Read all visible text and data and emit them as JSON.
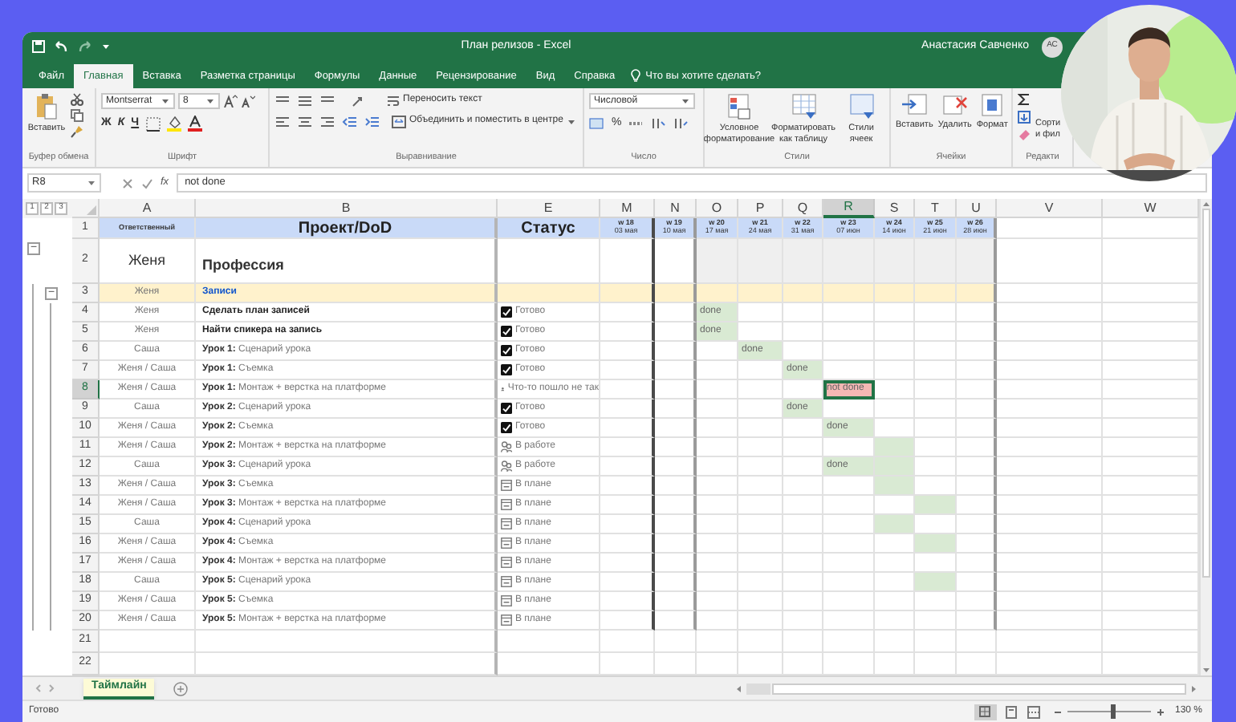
{
  "window": {
    "title": "План релизов  -  Excel",
    "user": "Анастасия Савченко",
    "avatar": "АС"
  },
  "tabs": [
    {
      "label": "Файл",
      "selected": false
    },
    {
      "label": "Главная",
      "selected": true
    },
    {
      "label": "Вставка",
      "selected": false
    },
    {
      "label": "Разметка страницы",
      "selected": false
    },
    {
      "label": "Формулы",
      "selected": false
    },
    {
      "label": "Данные",
      "selected": false
    },
    {
      "label": "Рецензирование",
      "selected": false
    },
    {
      "label": "Вид",
      "selected": false
    },
    {
      "label": "Справка",
      "selected": false
    }
  ],
  "tell_me": "Что вы хотите сделать?",
  "ribbon": {
    "clipboard": {
      "paste": "Вставить",
      "label": "Буфер обмена"
    },
    "font": {
      "name": "Montserrat",
      "size": "8",
      "styles": [
        "Ж",
        "К",
        "Ч"
      ],
      "label": "Шрифт"
    },
    "alignment": {
      "wrap": "Переносить текст",
      "merge": "Объединить и поместить в центре",
      "label": "Выравнивание"
    },
    "number": {
      "format": "Числовой",
      "percent": "%",
      "label": "Число"
    },
    "styles": {
      "buttons": [
        "Условное форматирование",
        "Форматировать как таблицу",
        "Стили ячеек"
      ],
      "label": "Стили"
    },
    "cells": {
      "buttons": [
        "Вставить",
        "Удалить",
        "Формат"
      ],
      "label": "Ячейки"
    },
    "editing": {
      "sort": [
        "Сорти",
        "и фил"
      ],
      "label": "Редакти"
    }
  },
  "formula_bar": {
    "name_box": "R8",
    "fx": "fx",
    "value": "not done"
  },
  "outline_levels": [
    "1",
    "2",
    "3"
  ],
  "columns": [
    {
      "letter": "A",
      "selected": false
    },
    {
      "letter": "B",
      "selected": false
    },
    {
      "letter": "E",
      "selected": false
    },
    {
      "letter": "M",
      "selected": false
    },
    {
      "letter": "N",
      "selected": false
    },
    {
      "letter": "O",
      "selected": false
    },
    {
      "letter": "P",
      "selected": false
    },
    {
      "letter": "Q",
      "selected": false
    },
    {
      "letter": "R",
      "selected": true
    },
    {
      "letter": "S",
      "selected": false
    },
    {
      "letter": "T",
      "selected": false
    },
    {
      "letter": "U",
      "selected": false
    },
    {
      "letter": "V",
      "selected": false
    },
    {
      "letter": "W",
      "selected": false
    }
  ],
  "header_row": {
    "number": "1",
    "responsible": "Ответственный",
    "project": "Проект/DoD",
    "status": "Статус",
    "weeks": [
      {
        "week": "w 18",
        "date": "03 мая"
      },
      {
        "week": "w 19",
        "date": "10 мая"
      },
      {
        "week": "w 20",
        "date": "17 мая"
      },
      {
        "week": "w 21",
        "date": "24 мая"
      },
      {
        "week": "w 22",
        "date": "31 мая"
      },
      {
        "week": "w 23",
        "date": "07 июн"
      },
      {
        "week": "w 24",
        "date": "14 июн"
      },
      {
        "week": "w 25",
        "date": "21 июн"
      },
      {
        "week": "w 26",
        "date": "28 июн"
      }
    ]
  },
  "rows": [
    {
      "number": "2",
      "kind": "group",
      "selected": false,
      "outline_toggle": "−",
      "responsible": "Женя",
      "task": "Профессия"
    },
    {
      "number": "3",
      "kind": "section",
      "selected": false,
      "outline_toggle": "−",
      "responsible": "Женя",
      "task": "Записи"
    },
    {
      "number": "4",
      "kind": "task",
      "selected": false,
      "bold": true,
      "responsible": "Женя",
      "task": "Сделать план записей",
      "status": {
        "kind": "done",
        "text": "Готово"
      },
      "weeks": [
        {
          "kind": "fill",
          "color": "#d9ead3",
          "text": "done"
        },
        {
          "kind": "blank"
        },
        {
          "kind": "blank"
        },
        {
          "kind": "blank"
        },
        {
          "kind": "blank"
        },
        {
          "kind": "blank"
        },
        {
          "kind": "blank"
        }
      ]
    },
    {
      "number": "5",
      "kind": "task",
      "selected": false,
      "bold": true,
      "responsible": "Женя",
      "task": "Найти спикера на запись",
      "status": {
        "kind": "done",
        "text": "Готово"
      },
      "weeks": [
        {
          "kind": "fill",
          "color": "#d9ead3",
          "text": "done"
        },
        {
          "kind": "blank"
        },
        {
          "kind": "blank"
        },
        {
          "kind": "blank"
        },
        {
          "kind": "blank"
        },
        {
          "kind": "blank"
        },
        {
          "kind": "blank"
        }
      ]
    },
    {
      "number": "6",
      "kind": "task",
      "selected": false,
      "bold": false,
      "responsible": "Саша",
      "task": "**Урок 1:** Сценарий урока",
      "status": {
        "kind": "done",
        "text": "Готово"
      },
      "weeks": [
        {
          "kind": "blank"
        },
        {
          "kind": "fill",
          "color": "#d9ead3",
          "text": "done"
        },
        {
          "kind": "blank"
        },
        {
          "kind": "blank"
        },
        {
          "kind": "blank"
        },
        {
          "kind": "blank"
        },
        {
          "kind": "blank"
        }
      ]
    },
    {
      "number": "7",
      "kind": "task",
      "selected": false,
      "bold": false,
      "responsible": "Женя / Саша",
      "task": "**Урок 1:** Съемка",
      "status": {
        "kind": "done",
        "text": "Готово"
      },
      "weeks": [
        {
          "kind": "blank"
        },
        {
          "kind": "blank"
        },
        {
          "kind": "fill",
          "color": "#d9ead3",
          "text": "done"
        },
        {
          "kind": "blank"
        },
        {
          "kind": "blank"
        },
        {
          "kind": "blank"
        },
        {
          "kind": "blank"
        }
      ]
    },
    {
      "number": "8",
      "kind": "task",
      "selected": true,
      "bold": false,
      "responsible": "Женя / Саша",
      "task": "**Урок 1:** Монтаж + верстка на платформе",
      "status": {
        "kind": "problem",
        "text": "Что-то пошло не так"
      },
      "weeks": [
        {
          "kind": "blank"
        },
        {
          "kind": "blank"
        },
        {
          "kind": "blank"
        },
        {
          "kind": "fill",
          "color": "#f4b8b4",
          "text": "not done"
        },
        {
          "kind": "blank"
        },
        {
          "kind": "blank"
        },
        {
          "kind": "blank"
        }
      ]
    },
    {
      "number": "9",
      "kind": "task",
      "selected": false,
      "bold": false,
      "responsible": "Саша",
      "task": "**Урок 2:** Сценарий урока",
      "status": {
        "kind": "done",
        "text": "Готово"
      },
      "weeks": [
        {
          "kind": "blank"
        },
        {
          "kind": "blank"
        },
        {
          "kind": "fill",
          "color": "#d9ead3",
          "text": "done"
        },
        {
          "kind": "blank"
        },
        {
          "kind": "blank"
        },
        {
          "kind": "blank"
        },
        {
          "kind": "blank"
        }
      ]
    },
    {
      "number": "10",
      "kind": "task",
      "selected": false,
      "bold": false,
      "responsible": "Женя / Саша",
      "task": "**Урок 2:** Съемка",
      "status": {
        "kind": "done",
        "text": "Готово"
      },
      "weeks": [
        {
          "kind": "blank"
        },
        {
          "kind": "blank"
        },
        {
          "kind": "blank"
        },
        {
          "kind": "fill",
          "color": "#d9ead3",
          "text": "done"
        },
        {
          "kind": "blank"
        },
        {
          "kind": "blank"
        },
        {
          "kind": "blank"
        }
      ]
    },
    {
      "number": "11",
      "kind": "task",
      "selected": false,
      "bold": false,
      "responsible": "Женя / Саша",
      "task": "**Урок 2:** Монтаж + верстка на платформе",
      "status": {
        "kind": "in_progress",
        "text": "В работе"
      },
      "weeks": [
        {
          "kind": "blank"
        },
        {
          "kind": "blank"
        },
        {
          "kind": "blank"
        },
        {
          "kind": "blank"
        },
        {
          "kind": "fill",
          "color": "#d9ead3"
        },
        {
          "kind": "blank"
        },
        {
          "kind": "blank"
        }
      ]
    },
    {
      "number": "12",
      "kind": "task",
      "selected": false,
      "bold": false,
      "responsible": "Саша",
      "task": "**Урок 3:** Сценарий урока",
      "status": {
        "kind": "in_progress",
        "text": "В работе"
      },
      "weeks": [
        {
          "kind": "blank"
        },
        {
          "kind": "blank"
        },
        {
          "kind": "blank"
        },
        {
          "kind": "fill",
          "color": "#d9ead3",
          "text": "done"
        },
        {
          "kind": "fill",
          "color": "#d9ead3"
        },
        {
          "kind": "blank"
        },
        {
          "kind": "blank"
        }
      ]
    },
    {
      "number": "13",
      "kind": "task",
      "selected": false,
      "bold": false,
      "responsible": "Женя / Саша",
      "task": "**Урок 3:** Съемка",
      "status": {
        "kind": "planned",
        "text": "В плане"
      },
      "weeks": [
        {
          "kind": "blank"
        },
        {
          "kind": "blank"
        },
        {
          "kind": "blank"
        },
        {
          "kind": "blank"
        },
        {
          "kind": "fill",
          "color": "#d9ead3"
        },
        {
          "kind": "blank"
        },
        {
          "kind": "blank"
        }
      ]
    },
    {
      "number": "14",
      "kind": "task",
      "selected": false,
      "bold": false,
      "responsible": "Женя / Саша",
      "task": "**Урок 3:** Монтаж + верстка на платформе",
      "status": {
        "kind": "planned",
        "text": "В плане"
      },
      "weeks": [
        {
          "kind": "blank"
        },
        {
          "kind": "blank"
        },
        {
          "kind": "blank"
        },
        {
          "kind": "blank"
        },
        {
          "kind": "blank"
        },
        {
          "kind": "fill",
          "color": "#d9ead3"
        },
        {
          "kind": "blank"
        }
      ]
    },
    {
      "number": "15",
      "kind": "task",
      "selected": false,
      "bold": false,
      "responsible": "Саша",
      "task": "**Урок 4:** Сценарий урока",
      "status": {
        "kind": "planned",
        "text": "В плане"
      },
      "weeks": [
        {
          "kind": "blank"
        },
        {
          "kind": "blank"
        },
        {
          "kind": "blank"
        },
        {
          "kind": "blank"
        },
        {
          "kind": "fill",
          "color": "#d9ead3"
        },
        {
          "kind": "blank"
        },
        {
          "kind": "blank"
        }
      ]
    },
    {
      "number": "16",
      "kind": "task",
      "selected": false,
      "bold": false,
      "responsible": "Женя / Саша",
      "task": "**Урок 4:** Съемка",
      "status": {
        "kind": "planned",
        "text": "В плане"
      },
      "weeks": [
        {
          "kind": "blank"
        },
        {
          "kind": "blank"
        },
        {
          "kind": "blank"
        },
        {
          "kind": "blank"
        },
        {
          "kind": "blank"
        },
        {
          "kind": "fill",
          "color": "#d9ead3"
        },
        {
          "kind": "blank"
        }
      ]
    },
    {
      "number": "17",
      "kind": "task",
      "selected": false,
      "bold": false,
      "responsible": "Женя / Саша",
      "task": "**Урок 4:** Монтаж + верстка на платформе",
      "status": {
        "kind": "planned",
        "text": "В плане"
      },
      "weeks": [
        {
          "kind": "blank"
        },
        {
          "kind": "blank"
        },
        {
          "kind": "blank"
        },
        {
          "kind": "blank"
        },
        {
          "kind": "blank"
        },
        {
          "kind": "blank"
        },
        {
          "kind": "blank"
        }
      ]
    },
    {
      "number": "18",
      "kind": "task",
      "selected": false,
      "bold": false,
      "responsible": "Саша",
      "task": "**Урок 5:** Сценарий урока",
      "status": {
        "kind": "planned",
        "text": "В плане"
      },
      "weeks": [
        {
          "kind": "blank"
        },
        {
          "kind": "blank"
        },
        {
          "kind": "blank"
        },
        {
          "kind": "blank"
        },
        {
          "kind": "blank"
        },
        {
          "kind": "fill",
          "color": "#d9ead3"
        },
        {
          "kind": "blank"
        }
      ]
    },
    {
      "number": "19",
      "kind": "task",
      "selected": false,
      "bold": false,
      "responsible": "Женя / Саша",
      "task": "**Урок 5:** Съемка",
      "status": {
        "kind": "planned",
        "text": "В плане"
      },
      "weeks": [
        {
          "kind": "blank"
        },
        {
          "kind": "blank"
        },
        {
          "kind": "blank"
        },
        {
          "kind": "blank"
        },
        {
          "kind": "blank"
        },
        {
          "kind": "blank"
        },
        {
          "kind": "blank"
        }
      ]
    },
    {
      "number": "20",
      "kind": "task",
      "selected": false,
      "bold": false,
      "responsible": "Женя / Саша",
      "task": "**Урок 5:** Монтаж + верстка на платформе",
      "status": {
        "kind": "planned",
        "text": "В плане"
      },
      "weeks": [
        {
          "kind": "blank"
        },
        {
          "kind": "blank"
        },
        {
          "kind": "blank"
        },
        {
          "kind": "blank"
        },
        {
          "kind": "blank"
        },
        {
          "kind": "blank"
        },
        {
          "kind": "blank"
        }
      ]
    },
    {
      "number": "21",
      "kind": "empty",
      "selected": false
    },
    {
      "number": "22",
      "kind": "empty",
      "selected": false
    }
  ],
  "sheet_tabs": [
    {
      "label": "Таймлайн",
      "selected": true
    }
  ],
  "status_bar": {
    "status": "Готово",
    "zoom": {
      "level": 0.55,
      "reading": "130 %"
    }
  }
}
